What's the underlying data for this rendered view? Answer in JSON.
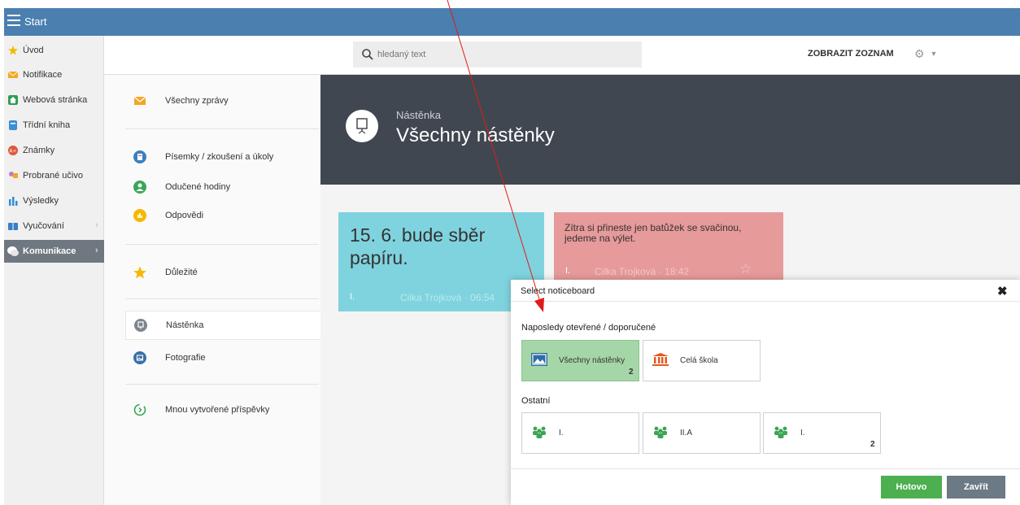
{
  "topbar": {
    "title": "Start"
  },
  "sidebar": {
    "items": [
      {
        "label": "Úvod",
        "icon": "star-icon",
        "color": "#f5b800"
      },
      {
        "label": "Notifikace",
        "icon": "envelope-icon",
        "color": "#f5a623"
      },
      {
        "label": "Webová stránka",
        "icon": "home-icon",
        "color": "#2e9e4f"
      },
      {
        "label": "Třídní kniha",
        "icon": "book-icon",
        "color": "#3a8fd6"
      },
      {
        "label": "Známky",
        "icon": "grades-icon",
        "color": "#e0573a"
      },
      {
        "label": "Probrané učivo",
        "icon": "teacher-icon",
        "color": "#c07ad0"
      },
      {
        "label": "Výsledky",
        "icon": "bar-chart-icon",
        "color": "#2d8fd6"
      },
      {
        "label": "Vyučování",
        "icon": "book-open-icon",
        "color": "#3a7fc4"
      },
      {
        "label": "Komunikace",
        "icon": "chat-icon",
        "color": "#ffffff"
      }
    ]
  },
  "header": {
    "search_placeholder": "hledaný text",
    "list_button": "ZOBRAZIT ZOZNAM"
  },
  "submenu": {
    "items": [
      {
        "label": "Všechny zprávy",
        "icon": "envelope-icon"
      },
      {
        "label": "Písemky / zkoušení a úkoly",
        "icon": "tests-icon"
      },
      {
        "label": "Odučené hodiny",
        "icon": "lessons-icon"
      },
      {
        "label": "Odpovědi",
        "icon": "answers-icon"
      },
      {
        "label": "Důležité",
        "icon": "star-icon"
      },
      {
        "label": "Nástěnka",
        "icon": "noticeboard-icon"
      },
      {
        "label": "Fotografie",
        "icon": "photo-icon"
      },
      {
        "label": "Mnou vytvořené příspěvky",
        "icon": "my-posts-icon"
      }
    ]
  },
  "banner": {
    "subtitle": "Nástěnka",
    "title": "Všechny nástěnky"
  },
  "notes": [
    {
      "text": "15. 6. bude sběr papíru.",
      "group": "I.",
      "author": "Cilka Trojková",
      "time": "06:54"
    },
    {
      "text": "Zítra si přineste jen batůžek se svačinou, jedeme na výlet.",
      "group": "I.",
      "author": "Cilka Trojková",
      "time": "18:42"
    }
  ],
  "modal": {
    "title": "Select noticeboard",
    "recent_heading": "Naposledy otevřené / doporučené",
    "recent": [
      {
        "label": "Všechny nástěnky",
        "count": "2"
      },
      {
        "label": "Celá škola",
        "count": ""
      }
    ],
    "other_heading": "Ostatní",
    "other": [
      {
        "label": "I.",
        "count": ""
      },
      {
        "label": "II.A",
        "count": ""
      },
      {
        "label": "I.",
        "count": "2"
      }
    ],
    "ok_label": "Hotovo",
    "close_label": "Zavřít"
  },
  "colors": {
    "topbar": "#4a7fb0",
    "active_sidebar": "#6f7880",
    "banner": "#404750",
    "note_blue": "#7fd3de",
    "note_red": "#e69a9a",
    "selected_tile": "#a5d6a7",
    "ok_button": "#4caf50"
  }
}
